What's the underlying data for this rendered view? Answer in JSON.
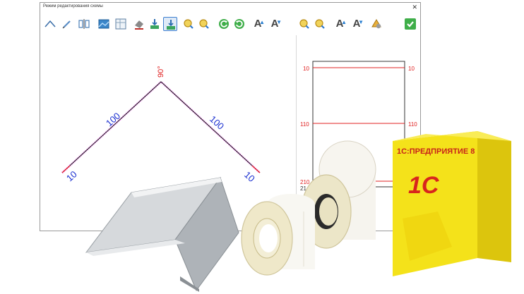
{
  "window": {
    "title": "Режим редактирования схемы"
  },
  "drawing": {
    "angle_label": "90°",
    "side_left_label": "100",
    "side_right_label": "100",
    "hem_left_label": "10",
    "hem_right_label": "10"
  },
  "roll": {
    "mark_top_left": "10",
    "mark_top_right": "10",
    "mark_mid_left": "110",
    "mark_mid_right": "110",
    "mark_bottom_left": "210",
    "mark_bottom_cut": "21"
  },
  "product_box": {
    "brand_text": "1С:ПРЕДПРИЯТИЕ 8",
    "logo_text": "1С"
  },
  "colors": {
    "dimension_text": "#1a2fd0",
    "mark_red": "#e02020",
    "box_yellow": "#f4e21a",
    "box_logo_red": "#d8251d"
  }
}
